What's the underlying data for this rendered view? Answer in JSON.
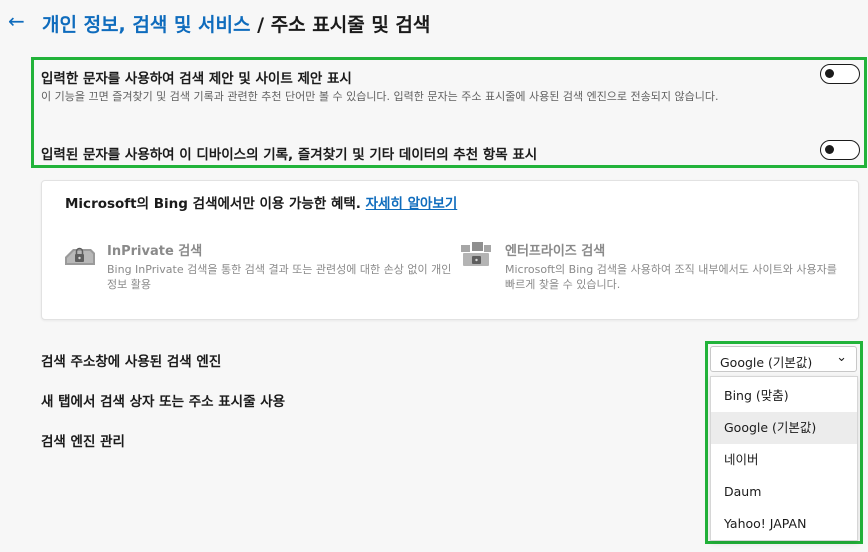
{
  "header": {
    "back_icon": "back-arrow-icon",
    "breadcrumb_parent": "개인 정보, 검색 및 서비스",
    "separator": "/",
    "page_title": "주소 표시줄 및 검색"
  },
  "suggestions": {
    "search_suggestions_title": "입력한 문자를 사용하여 검색 제안 및 사이트 제안 표시",
    "search_suggestions_desc": "이 기능을 끄면 즐겨찾기 및 검색 기록과 관련한 추천 단어만 볼 수 있습니다. 입력한 문자는 주소 표시줄에 사용된 검색 엔진으로 전송되지 않습니다.",
    "search_suggestions_enabled": false,
    "device_suggestions_title": "입력된 문자를 사용하여 이 디바이스의 기록, 즐겨찾기 및 기타 데이터의 추천 항목 표시",
    "device_suggestions_enabled": false,
    "highlight_color": "#22b33a"
  },
  "bing_card": {
    "heading": "Microsoft의 Bing 검색에서만 이용 가능한 혜택.",
    "learn_more": "자세히 알아보기",
    "features": [
      {
        "icon": "inprivate-search-icon",
        "title": "InPrivate 검색",
        "desc": "Bing InPrivate 검색을 통한 검색 결과 또는 관련성에 대한 손상 없이 개인 정보 활용"
      },
      {
        "icon": "enterprise-search-icon",
        "title": "엔터프라이즈 검색",
        "desc": "Microsoft의 Bing 검색을 사용하여 조직 내부에서도 사이트와 사용자를 빠르게 찾을 수 있습니다."
      }
    ]
  },
  "settings": {
    "engine_label": "검색 주소창에 사용된 검색 엔진",
    "new_tab_label": "새 탭에서 검색 상자 또는 주소 표시줄 사용",
    "manage_label": "검색 엔진 관리"
  },
  "engine_dropdown": {
    "selected": "Google (기본값)",
    "chevron_icon": "chevron-down-icon",
    "options": [
      "Bing (맞춤)",
      "Google (기본값)",
      "네이버",
      "Daum",
      "Yahoo! JAPAN"
    ],
    "hovered_option": "Google (기본값)"
  },
  "colors": {
    "accent": "#0f6cbd",
    "highlight": "#22b33a",
    "background": "#f7f7f7"
  }
}
